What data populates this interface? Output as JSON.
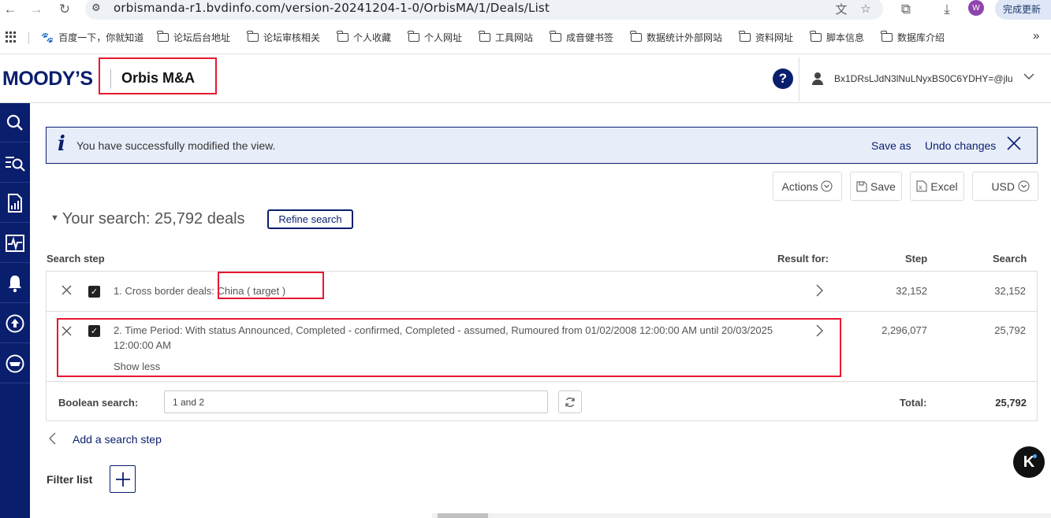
{
  "browser": {
    "url": "orbismanda-r1.bvdinfo.com/version-20241204-1-0/OrbisMA/1/Deals/List",
    "profile_initial": "W",
    "update_label": "完成更新",
    "bookmarks": [
      "百度一下，你就知道",
      "论坛后台地址",
      "论坛审核相关",
      "个人收藏",
      "个人网址",
      "工具网站",
      "成音健书签",
      "数据统计外部网站",
      "资料网址",
      "脚本信息",
      "数据库介绍"
    ]
  },
  "header": {
    "logo": "MOODY’S",
    "product": "Orbis M&A",
    "help": "?",
    "user": "Bx1DRsLJdN3lNuLNyxBS0C6YDHY=@jlu"
  },
  "banner": {
    "icon": "i",
    "message": "You have successfully modified the view.",
    "save_as": "Save as",
    "undo": "Undo changes"
  },
  "toolbar": {
    "actions": "Actions",
    "save": "Save",
    "excel": "Excel",
    "currency": "USD"
  },
  "search": {
    "title": "Your search: 25,792 deals",
    "refine": "Refine search",
    "col_step_label": "Search step",
    "col_result_for": "Result for:",
    "col_step": "Step",
    "col_search": "Search",
    "steps": [
      {
        "text_prefix": "1. Cross border deals: ",
        "text_highlight": "China ( target )",
        "step": "32,152",
        "search": "32,152"
      },
      {
        "text": "2. Time Period: With status Announced, Completed - confirmed, Completed - assumed, Rumoured from 01/02/2008 12:00:00 AM until 20/03/2025 12:00:00 AM",
        "show_less": "Show less",
        "step": "2,296,077",
        "search": "25,792"
      }
    ],
    "boolean_label": "Boolean search:",
    "boolean_value": "1 and 2",
    "total_label": "Total:",
    "total_value": "25,792"
  },
  "add_step": "Add a search step",
  "filter_list": "Filter list",
  "fab_label": "K"
}
